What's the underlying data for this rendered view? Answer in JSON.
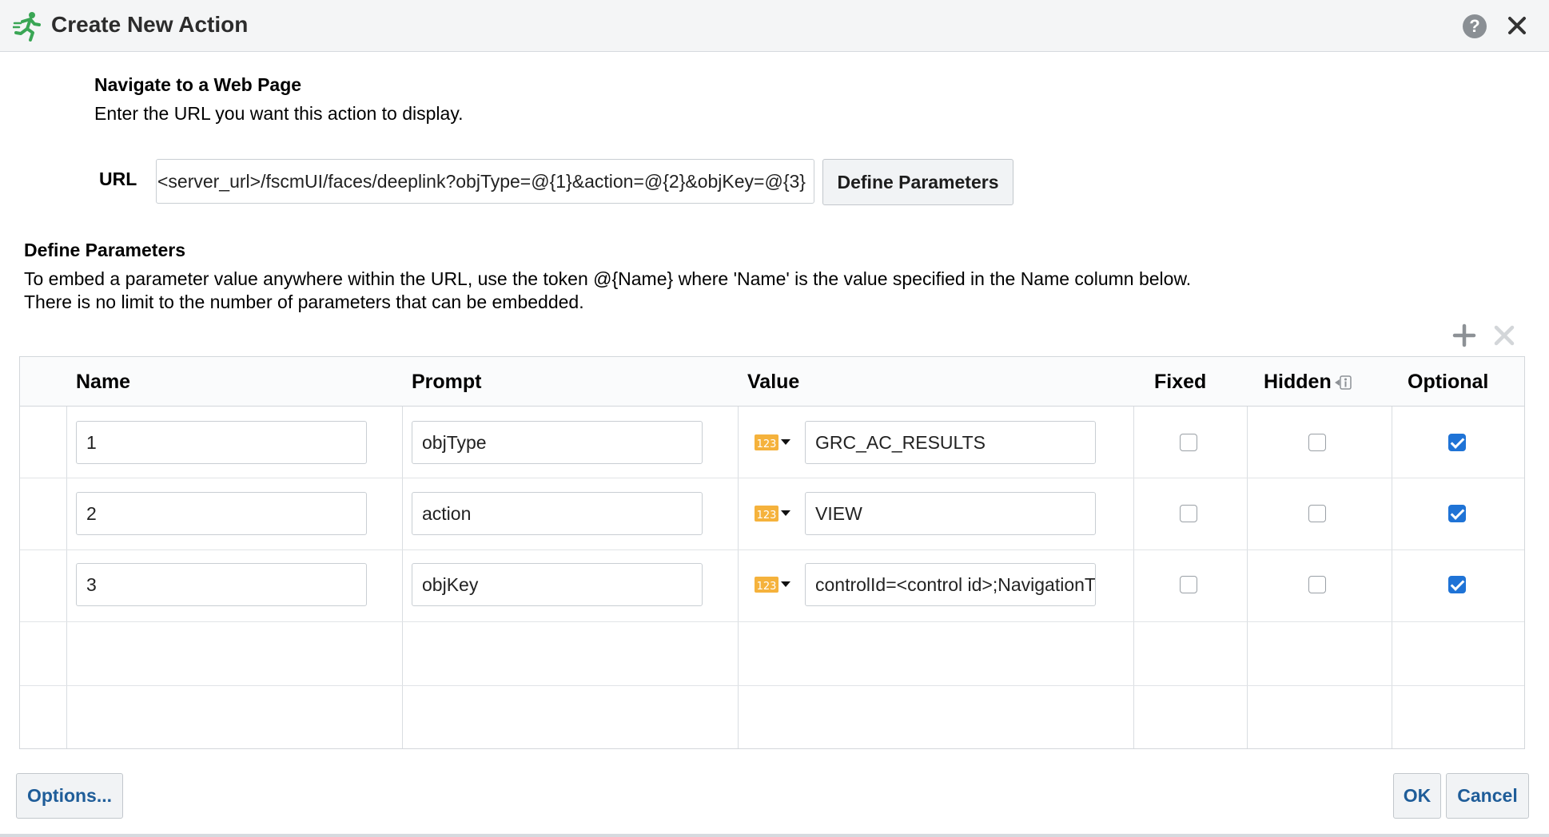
{
  "dialog": {
    "title": "Create New Action",
    "title_icon": "running-person-icon",
    "help_label": "?",
    "accent": "#1f5d99"
  },
  "navigate": {
    "title": "Navigate to a Web Page",
    "description": "Enter the URL you want this action to display.",
    "url_label": "URL",
    "url_value": "<server_url>/fscmUI/faces/deeplink?objType=@{1}&action=@{2}&objKey=@{3}",
    "define_button": "Define Parameters"
  },
  "parameters": {
    "title": "Define Parameters",
    "desc_line1": "To embed a parameter value anywhere within the URL, use the token @{Name} where 'Name' is the value specified in the Name column below.",
    "desc_line2": "There is no limit to the number of parameters that can be embedded.",
    "columns": {
      "name": "Name",
      "prompt": "Prompt",
      "value": "Value",
      "fixed": "Fixed",
      "hidden": "Hidden",
      "optional": "Optional"
    },
    "rows": [
      {
        "name": "1",
        "prompt": "objType",
        "value": "GRC_AC_RESULTS",
        "fixed": false,
        "hidden": false,
        "optional": true
      },
      {
        "name": "2",
        "prompt": "action",
        "value": "VIEW",
        "fixed": false,
        "hidden": false,
        "optional": true
      },
      {
        "name": "3",
        "prompt": "objKey",
        "value": "controlId=<control id>;NavigationType=C",
        "fixed": false,
        "hidden": false,
        "optional": true
      }
    ],
    "type_icon_label": "123"
  },
  "footer": {
    "options_button": "Options...",
    "ok_button": "OK",
    "cancel_button": "Cancel"
  }
}
